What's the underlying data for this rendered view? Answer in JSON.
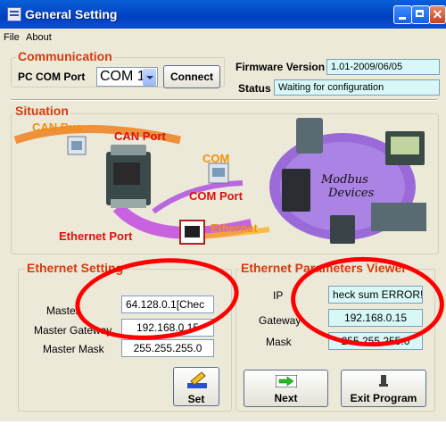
{
  "window": {
    "title": "General Setting"
  },
  "menu": {
    "file": "File",
    "about": "About"
  },
  "communication": {
    "title": "Communication",
    "port_label": "PC COM Port",
    "port_value": "COM 1",
    "connect_label": "Connect",
    "firmware_label": "Firmware Version",
    "firmware_value": "1.01-2009/06/05",
    "status_label": "Status",
    "status_value": "Waiting for configuration"
  },
  "situation": {
    "title": "Situation",
    "labels": {
      "can_bus": "CAN Bus",
      "can_port": "CAN Port",
      "com": "COM",
      "com_port": "COM Port",
      "ethernet": "Ethernet",
      "ethernet_port": "Ethernet Port",
      "modbus_devices": "Modbus Devices"
    }
  },
  "ethernet_setting": {
    "title": "Ethernet Setting",
    "master_label": "Master",
    "master_value": "64.128.0.1[Chec",
    "gateway_label": "Master Gateway",
    "gateway_value": "192.168.0.15",
    "mask_label": "Master Mask",
    "mask_value": "255.255.255.0",
    "set_label": "Set"
  },
  "ethernet_viewer": {
    "title": "Ethernet Parameters Viewer",
    "ip_label": "IP",
    "ip_value": "heck sum ERROR!",
    "gateway_label": "Gateway",
    "gateway_value": "192.168.0.15",
    "mask_label": "Mask",
    "mask_value": "255.255.255.0",
    "next_label": "Next",
    "exit_label": "Exit Program"
  },
  "colors": {
    "accent_label": "#d83a0c",
    "annotation": "#ff0000",
    "readonly_bg": "#d8f8f8"
  }
}
